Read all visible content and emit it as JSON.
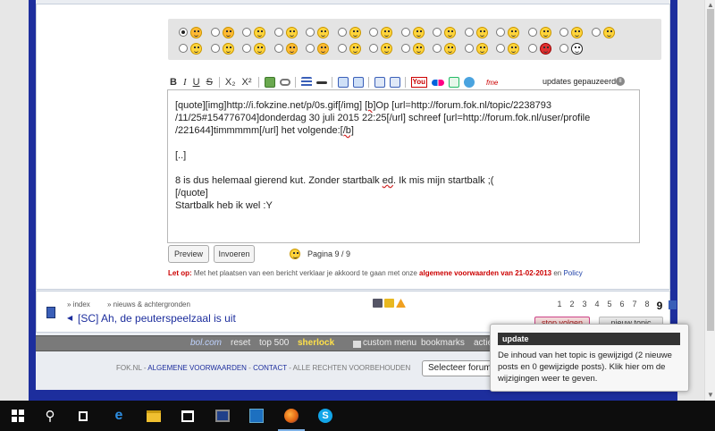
{
  "colors": {
    "page_blue": "#1d2e9d",
    "terms_red": "#c00000",
    "nav_gray": "#7a7a7a",
    "sherlock_yellow": "#ffe14a",
    "taskbar": "#0d0d0d"
  },
  "smileys": {
    "row1": [
      "note",
      "arrow",
      "bulb",
      "warning",
      "cool",
      "smile",
      "tongue",
      "grin",
      "sunglasses",
      "happy",
      "skeptic",
      "smirk",
      "worry",
      "laugh"
    ],
    "row2": [
      "shock",
      "wink",
      "silly",
      "thumbs-down",
      "thumbs-up",
      "sleep",
      "sweat",
      "blush",
      "flex",
      "evil",
      "fun",
      "superman",
      "football"
    ],
    "selected": 0
  },
  "toolbar": {
    "bold": "B",
    "italic": "I",
    "underline": "U",
    "strike": "S",
    "subscript": "X₂",
    "superscript": "X²",
    "youtube": "You",
    "fme": "fme",
    "updates_label": "updates gepauzeerd"
  },
  "editor": {
    "line1_a": "[quote][img]http://i.fokzine.net/p/0s.gif[/img] ",
    "line1_wavy": "[b]",
    "line1_b": "Op [url=http://forum.fok.nl/topic/2238793",
    "line2": "/11/25#154776704]donderdag 30 juli 2015 22:25[/url] schreef [url=http://forum.fok.nl/user/profile",
    "line3_a": "/221644]timmmmm[/url] het volgende:",
    "line3_wavy": "[/b]",
    "line5": "[..]",
    "line7_a": "8 is dus helemaal gierend kut. Zonder startbalk ",
    "line7_wavy": "ed",
    "line7_b": ". Ik mis mijn startbalk ;(",
    "line8": "[/quote]",
    "line9": "Startbalk heb ik wel :Y"
  },
  "buttons": {
    "preview": "Preview",
    "submit": "Invoeren",
    "pagina": "Pagina 9 / 9"
  },
  "terms": {
    "lead": "Let op:",
    "text": " Met het plaatsen van een bericht verklaar je akkoord te gaan met onze ",
    "link1": "algemene voorwaarden van 21-02-2013",
    "mid": " en ",
    "link2": "Policy"
  },
  "topic": {
    "crumb_index": "» index",
    "crumb_news": "» nieuws & achtergronden",
    "arrow": "◀",
    "title": "[SC] Ah, de peuterspeelzaal is uit",
    "pages": [
      "1",
      "2",
      "3",
      "4",
      "5",
      "6",
      "7",
      "8",
      "9"
    ],
    "current_page": "9",
    "stop_follow": "stop volgen",
    "new_topic": "nieuw topic"
  },
  "nav": {
    "bol": "bol.com",
    "reset": "reset",
    "top500": "top 500",
    "sherlock": "sherlock",
    "custom_menu": "custom menu",
    "bookmarks": "bookmarks",
    "actie": "actie"
  },
  "footer": {
    "fok": "FOK.NL - ",
    "terms": "ALGEMENE VOORWAARDEN",
    "sep": " - ",
    "contact": "CONTACT",
    "rights": " - ALLE RECHTEN VOORBEHOUDEN",
    "select": "Selecteer forum"
  },
  "popup": {
    "title": "update",
    "body": "De inhoud van het topic is gewijzigd (2 nieuwe posts en 0 gewijzigde posts). Klik hier om de wijzigingen weer te geven."
  },
  "taskbar": {
    "search_glyph": "⚲",
    "edge_glyph": "e",
    "skype_glyph": "S",
    "apps": [
      "start",
      "search",
      "task-view",
      "edge",
      "file-explorer",
      "store",
      "app",
      "app",
      "firefox",
      "skype"
    ]
  }
}
